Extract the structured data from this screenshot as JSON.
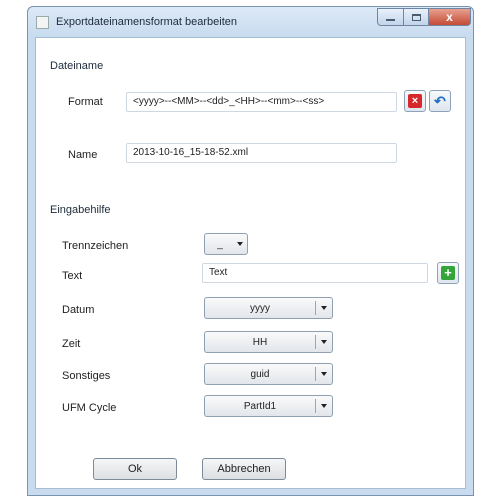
{
  "window": {
    "title": "Exportdateinamensformat bearbeiten",
    "close_glyph": "x"
  },
  "dateiname": {
    "group_label": "Dateiname",
    "format_label": "Format",
    "format_value": "<yyyy>--<MM>--<dd>_<HH>--<mm>--<ss>",
    "name_label": "Name",
    "name_value": "2013-10-16_15-18-52.xml"
  },
  "eingabehilfe": {
    "group_label": "Eingabehilfe",
    "trennzeichen_label": "Trennzeichen",
    "trennzeichen_value": "_",
    "text_label": "Text",
    "text_value": "Text",
    "datum_label": "Datum",
    "datum_value": "yyyy",
    "zeit_label": "Zeit",
    "zeit_value": "HH",
    "sonstiges_label": "Sonstiges",
    "sonstiges_value": "guid",
    "ufm_label": "UFM Cycle",
    "ufm_value": "PartId1"
  },
  "buttons": {
    "ok": "Ok",
    "cancel": "Abbrechen"
  },
  "icons": {
    "delete": "delete-icon",
    "undo": "undo-icon",
    "add": "add-icon",
    "delete_color": "#d6282a",
    "add_color": "#35a53a",
    "undo_color": "#1f6fc4"
  }
}
